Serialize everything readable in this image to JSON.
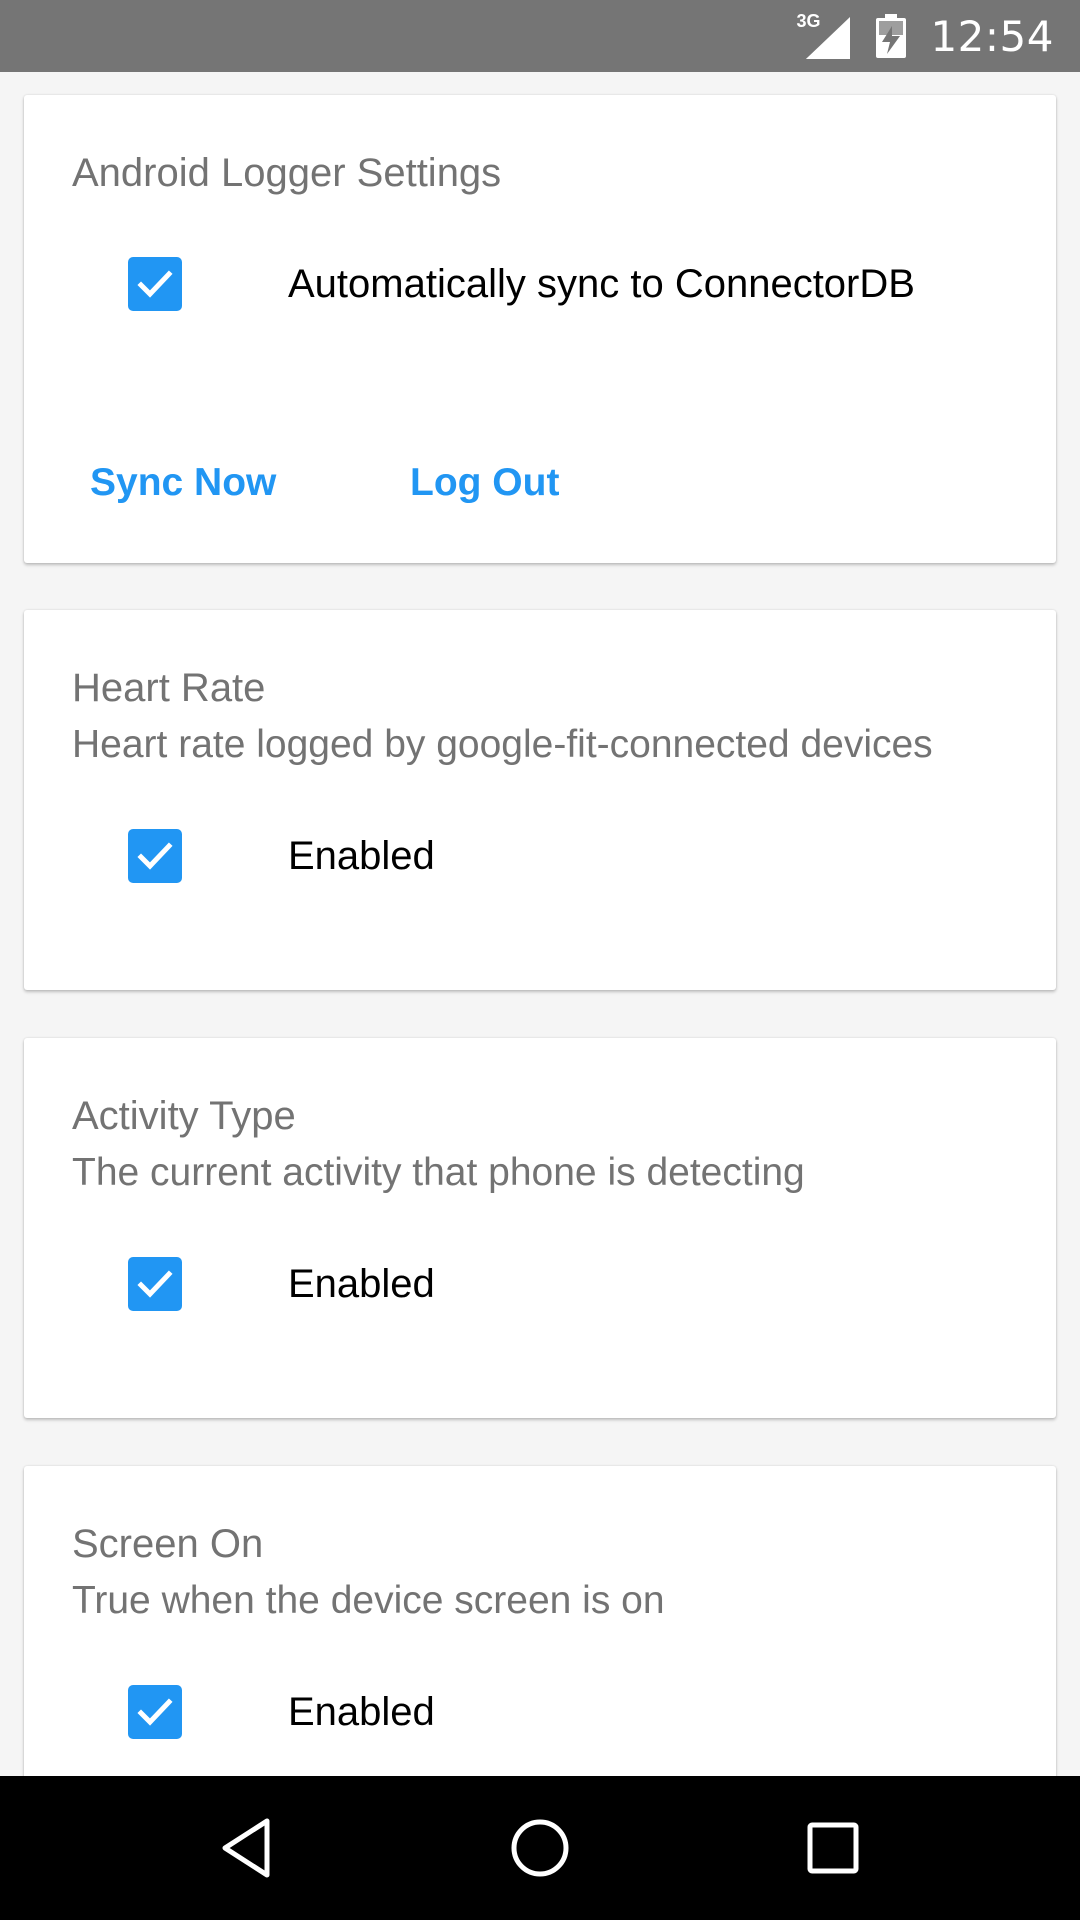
{
  "status_bar": {
    "network": "3G",
    "time": "12:54",
    "icons": [
      "signal-icon",
      "battery-charging-icon"
    ]
  },
  "settings_card": {
    "title": "Android Logger Settings",
    "auto_sync": {
      "label": "Automatically sync to ConnectorDB",
      "checked": true
    },
    "sync_now_label": "Sync Now",
    "log_out_label": "Log Out"
  },
  "loggers": [
    {
      "title": "Heart Rate",
      "description": "Heart rate logged by google-fit-connected devices",
      "enabled_label": "Enabled",
      "checked": true
    },
    {
      "title": "Activity Type",
      "description": "The current activity that phone is detecting",
      "enabled_label": "Enabled",
      "checked": true
    },
    {
      "title": "Screen On",
      "description": "True when the device screen is on",
      "enabled_label": "Enabled",
      "checked": true
    }
  ],
  "nav_bar": {
    "icons": [
      "back-icon",
      "home-icon",
      "recents-icon"
    ]
  },
  "colors": {
    "accent": "#2196f3",
    "status_bar": "#757575",
    "nav_bar": "#000000"
  }
}
